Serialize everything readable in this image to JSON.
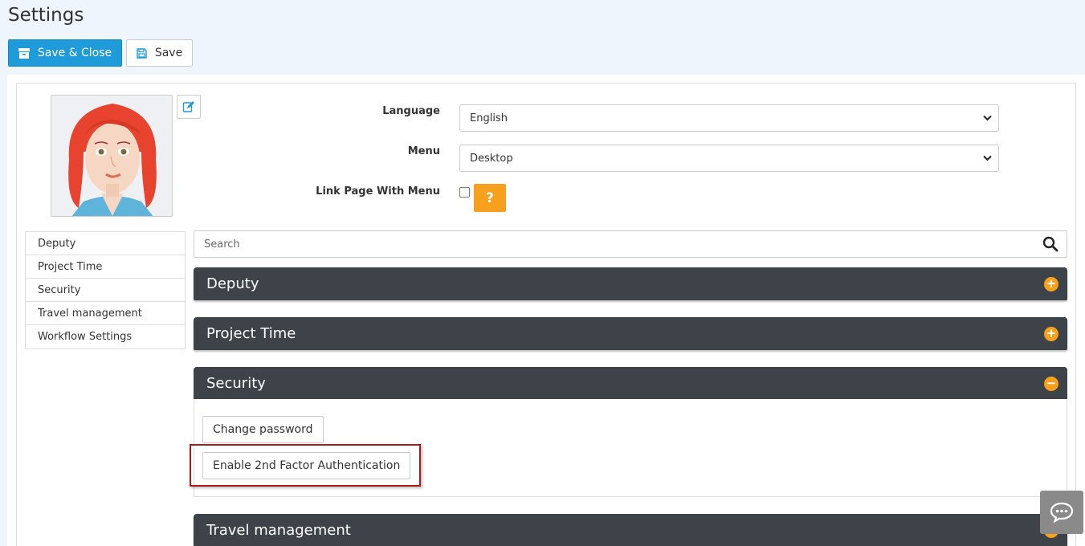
{
  "page": {
    "title": "Settings"
  },
  "toolbar": {
    "save_close_label": "Save & Close",
    "save_label": "Save"
  },
  "form": {
    "language_label": "Language",
    "language_value": "English",
    "menu_label": "Menu",
    "menu_value": "Desktop",
    "link_label": "Link Page With Menu",
    "link_checked": false,
    "help_label": "?"
  },
  "sidebar": {
    "items": [
      {
        "label": "Deputy"
      },
      {
        "label": "Project Time"
      },
      {
        "label": "Security"
      },
      {
        "label": "Travel management"
      },
      {
        "label": "Workflow Settings"
      }
    ]
  },
  "search": {
    "placeholder": "Search"
  },
  "sections": {
    "deputy": {
      "title": "Deputy",
      "state": "+"
    },
    "project_time": {
      "title": "Project Time",
      "state": "+"
    },
    "security": {
      "title": "Security",
      "state": "−",
      "change_password_label": "Change password",
      "enable_2fa_label": "Enable 2nd Factor Authentication"
    },
    "travel": {
      "title": "Travel management"
    }
  },
  "colors": {
    "primary": "#1f9bd9",
    "accent": "#f7a01d",
    "header": "#3d4348",
    "highlight": "#a81b1b"
  }
}
